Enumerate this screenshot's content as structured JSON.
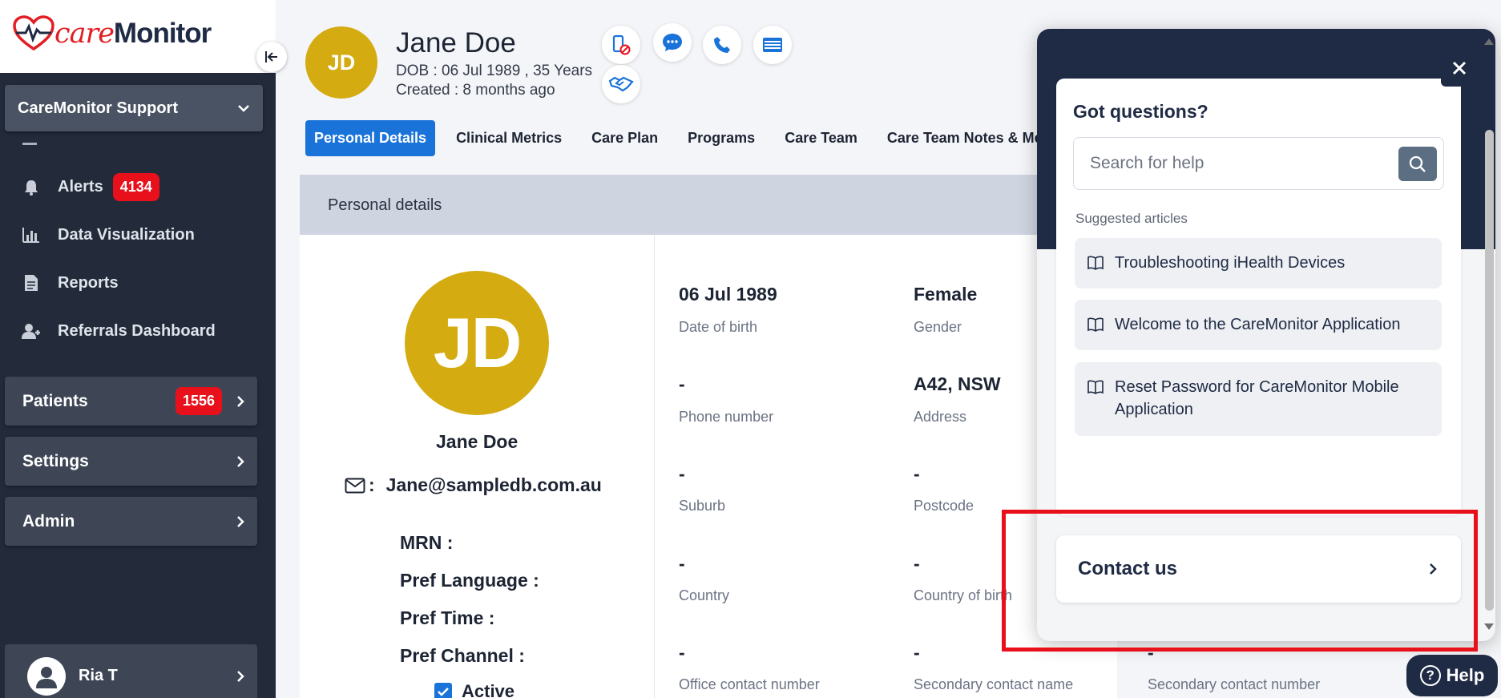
{
  "app": {
    "logo_care": "care",
    "logo_monitor": "Monitor"
  },
  "sidebar": {
    "org": "CareMonitor Support",
    "items": [
      {
        "label": "Alerts",
        "badge": "4134",
        "icon": "bell-icon"
      },
      {
        "label": "Data Visualization",
        "icon": "bar-chart-icon"
      },
      {
        "label": "Reports",
        "icon": "document-icon"
      },
      {
        "label": "Referrals Dashboard",
        "icon": "user-plus-icon"
      }
    ],
    "groups": [
      {
        "label": "Patients",
        "badge": "1556"
      },
      {
        "label": "Settings"
      },
      {
        "label": "Admin"
      }
    ],
    "user": "Ria T"
  },
  "patient": {
    "initials": "JD",
    "name": "Jane Doe",
    "dob_line": "DOB : 06 Jul 1989 , 35 Years",
    "created_line": "Created : 8 months ago",
    "email_prefix": ":",
    "email": "Jane@sampledb.com.au",
    "mrn": "MRN :",
    "pref_language": "Pref Language :",
    "pref_time": "Pref Time :",
    "pref_channel": "Pref Channel :",
    "active": "Active"
  },
  "tabs": [
    "Personal Details",
    "Clinical Metrics",
    "Care Plan",
    "Programs",
    "Care Team",
    "Care Team Notes & Messa"
  ],
  "section": {
    "title": "Personal details"
  },
  "fields": [
    {
      "value": "06 Jul 1989",
      "label": "Date of birth"
    },
    {
      "value": "Female",
      "label": "Gender"
    },
    {
      "value": "-",
      "label": "Phone number"
    },
    {
      "value": "A42, NSW",
      "label": "Address"
    },
    {
      "value": "-",
      "label": "Suburb"
    },
    {
      "value": "-",
      "label": "Postcode"
    },
    {
      "value": "-",
      "label": "Country"
    },
    {
      "value": "-",
      "label": "Country of birth"
    },
    {
      "value": "-",
      "label": "Office contact number"
    },
    {
      "value": "-",
      "label": "Secondary contact name"
    },
    {
      "value": "-",
      "label": "Secondary contact number"
    }
  ],
  "help": {
    "title": "Got questions?",
    "search_placeholder": "Search for help",
    "suggested_label": "Suggested articles",
    "articles": [
      "Troubleshooting iHealth Devices",
      "Welcome to the CareMonitor Application",
      "Reset Password for CareMonitor Mobile Application"
    ],
    "contact": "Contact us",
    "button": "Help"
  },
  "colors": {
    "accent": "#1a73d9",
    "sidebar": "#232b3b",
    "badge": "#e8101a",
    "avatar": "#d4ab10",
    "help_dark": "#1f2a44"
  }
}
